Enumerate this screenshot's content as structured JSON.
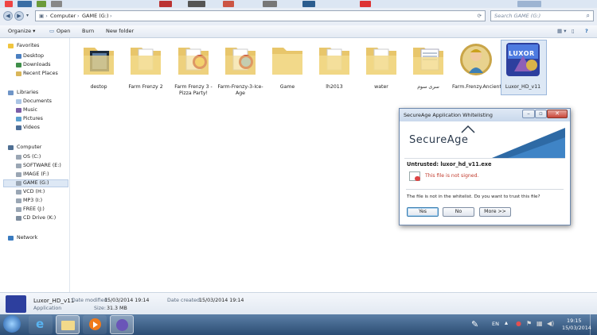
{
  "address": {
    "crumbs": [
      "Computer",
      "GAME (G:)"
    ]
  },
  "search": {
    "placeholder": "Search GAME (G:)"
  },
  "toolbar": {
    "organize": "Organize ▾",
    "open": "Open",
    "burn": "Burn",
    "new_folder": "New folder"
  },
  "sidebar": {
    "favorites": {
      "label": "Favorites",
      "items": [
        "Desktop",
        "Downloads",
        "Recent Places"
      ]
    },
    "libraries": {
      "label": "Libraries",
      "items": [
        "Documents",
        "Music",
        "Pictures",
        "Videos"
      ]
    },
    "computer": {
      "label": "Computer",
      "items": [
        "OS (C:)",
        "SOFTWARE (E:)",
        "IMAGE (F:)",
        "GAME (G:)",
        "VCD (H:)",
        "MP3 (I:)",
        "FREE (J:)",
        "CD Drive (K:)"
      ]
    },
    "network": {
      "label": "Network"
    }
  },
  "files": [
    "destop",
    "Farm Frenzy 2",
    "Farm Frenzy 3 - Pizza Party!",
    "Farm-Frenzy-3-Ice-Age",
    "Game",
    "lh2013",
    "water",
    "سری سوم",
    "Farm.Frenzy.Ancient.Rome",
    "Luxor_HD_v11"
  ],
  "details": {
    "name": "Luxor_HD_v11",
    "type": "Application",
    "modified_label": "Date modified:",
    "modified": "15/03/2014 19:14",
    "created_label": "Date created:",
    "created": "15/03/2014 19:14",
    "size_label": "Size:",
    "size": "31.3 MB"
  },
  "dialog": {
    "title": "SecureAge Application Whitelisting",
    "brand": "SecureAge",
    "heading": "Untrusted: luxor_hd_v11.exe",
    "warning": "This file is not signed.",
    "question": "The file is not in the whitelist. Do you want to trust this file?",
    "buttons": {
      "yes": "Yes",
      "no": "No",
      "more": "More >>"
    }
  },
  "luxor_icon_text": "LUXOR",
  "taskbar": {
    "lang": "EN",
    "time": "19:15",
    "date": "15/03/2014"
  },
  "colors": {
    "accent": "#3c7fb1",
    "dialog_warning": "#c0392b",
    "folder": "#f2d98a"
  }
}
